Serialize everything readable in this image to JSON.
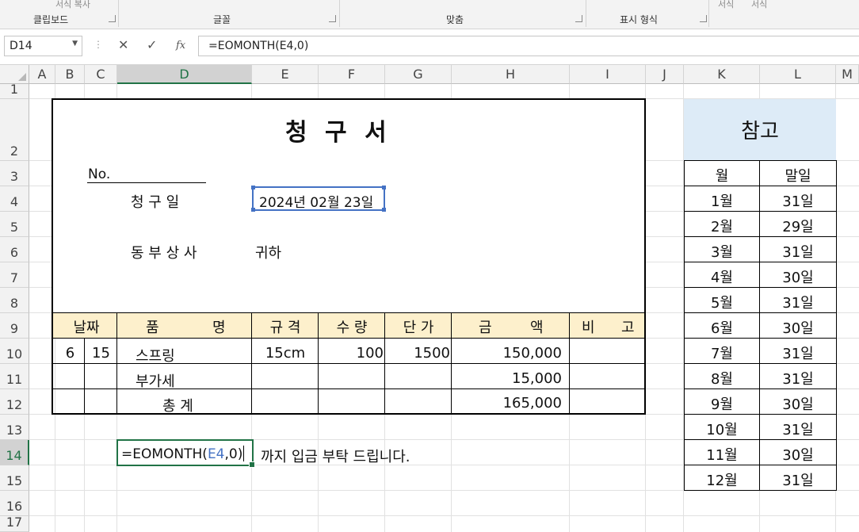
{
  "ribbon": {
    "groups": [
      "클립보드",
      "글꼴",
      "맞춤",
      "표시 형식"
    ],
    "faded_left": "서식 복사",
    "faded_right_1": "서식",
    "faded_right_2": "서식"
  },
  "formula_bar": {
    "name_box": "D14",
    "cancel_icon": "✕",
    "enter_icon": "✓",
    "fx_label": "fx",
    "formula": "=EOMONTH(E4,0)"
  },
  "columns": [
    "A",
    "B",
    "C",
    "D",
    "E",
    "F",
    "G",
    "H",
    "I",
    "J",
    "K",
    "L",
    "M"
  ],
  "rows": [
    "1",
    "2",
    "3",
    "4",
    "5",
    "6",
    "7",
    "8",
    "9",
    "10",
    "11",
    "12",
    "13",
    "14",
    "15",
    "16",
    "17"
  ],
  "invoice": {
    "title": "청 구 서",
    "no_label": "No.",
    "date_label": "청   구   일",
    "date_value": "2024년 02월 23일",
    "customer": "동 부 상 사",
    "honorific": "귀하",
    "headers": {
      "date": "날짜",
      "item_a": "품",
      "item_b": "명",
      "spec": "규  격",
      "qty": "수  량",
      "unit": "단  가",
      "amount_a": "금",
      "amount_b": "액",
      "note_a": "비",
      "note_b": "고"
    },
    "line": {
      "month": "6",
      "day": "15",
      "item": "스프링",
      "spec": "15cm",
      "qty": "100",
      "unit_price": "1500",
      "amount": "150,000"
    },
    "vat_label": "부가세",
    "vat": "15,000",
    "total_label": "총    계",
    "total": "165,000",
    "edit_formula_prefix": "=EOMONTH(",
    "edit_formula_ref": "E4",
    "edit_formula_suffix": ",0)",
    "payment_note": "까지 입금 부탁 드립니다."
  },
  "reference": {
    "title": "참고",
    "col_month": "월",
    "col_lastday": "말일",
    "rows": [
      {
        "month": "1월",
        "last": "31일"
      },
      {
        "month": "2월",
        "last": "29일"
      },
      {
        "month": "3월",
        "last": "31일"
      },
      {
        "month": "4월",
        "last": "30일"
      },
      {
        "month": "5월",
        "last": "31일"
      },
      {
        "month": "6월",
        "last": "30일"
      },
      {
        "month": "7월",
        "last": "31일"
      },
      {
        "month": "8월",
        "last": "31일"
      },
      {
        "month": "9월",
        "last": "30일"
      },
      {
        "month": "10월",
        "last": "31일"
      },
      {
        "month": "11월",
        "last": "30일"
      },
      {
        "month": "12월",
        "last": "31일"
      }
    ]
  },
  "colors": {
    "header_fill": "#fdf0cc",
    "reference_title_fill": "#ddebf7",
    "selection_green": "#217346",
    "ref_blue": "#4472c4"
  }
}
